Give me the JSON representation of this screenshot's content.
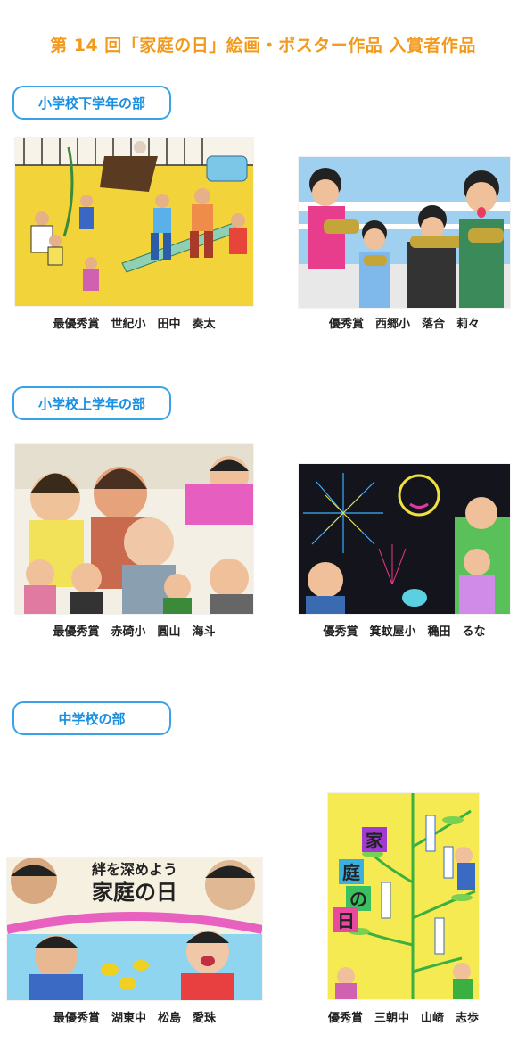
{
  "page_title": "第 14 回「家庭の日」絵画・ポスター作品 入賞者作品",
  "sections": [
    {
      "heading": "小学校下学年の部",
      "entries": [
        {
          "caption": "最優秀賞　世紀小　田中　奏太"
        },
        {
          "caption": "優秀賞　西郷小　落合　莉々"
        }
      ]
    },
    {
      "heading": "小学校上学年の部",
      "entries": [
        {
          "caption": "最優秀賞　赤碕小　圓山　海斗"
        },
        {
          "caption": "優秀賞　箕蚊屋小　穐田　るな"
        }
      ]
    },
    {
      "heading": "中学校の部",
      "entries": [
        {
          "caption": "最優秀賞　湖東中　松島　愛珠",
          "artwork_text": [
            "絆を深めよう",
            "家庭の日"
          ]
        },
        {
          "caption": "優秀賞　三朝中　山﨑　志歩",
          "artwork_text": [
            "家",
            "庭",
            "の",
            "日"
          ]
        }
      ]
    }
  ],
  "colors": {
    "title": "#f39a1c",
    "pill_border": "#3aa3e8",
    "pill_text": "#1a8fe0"
  }
}
